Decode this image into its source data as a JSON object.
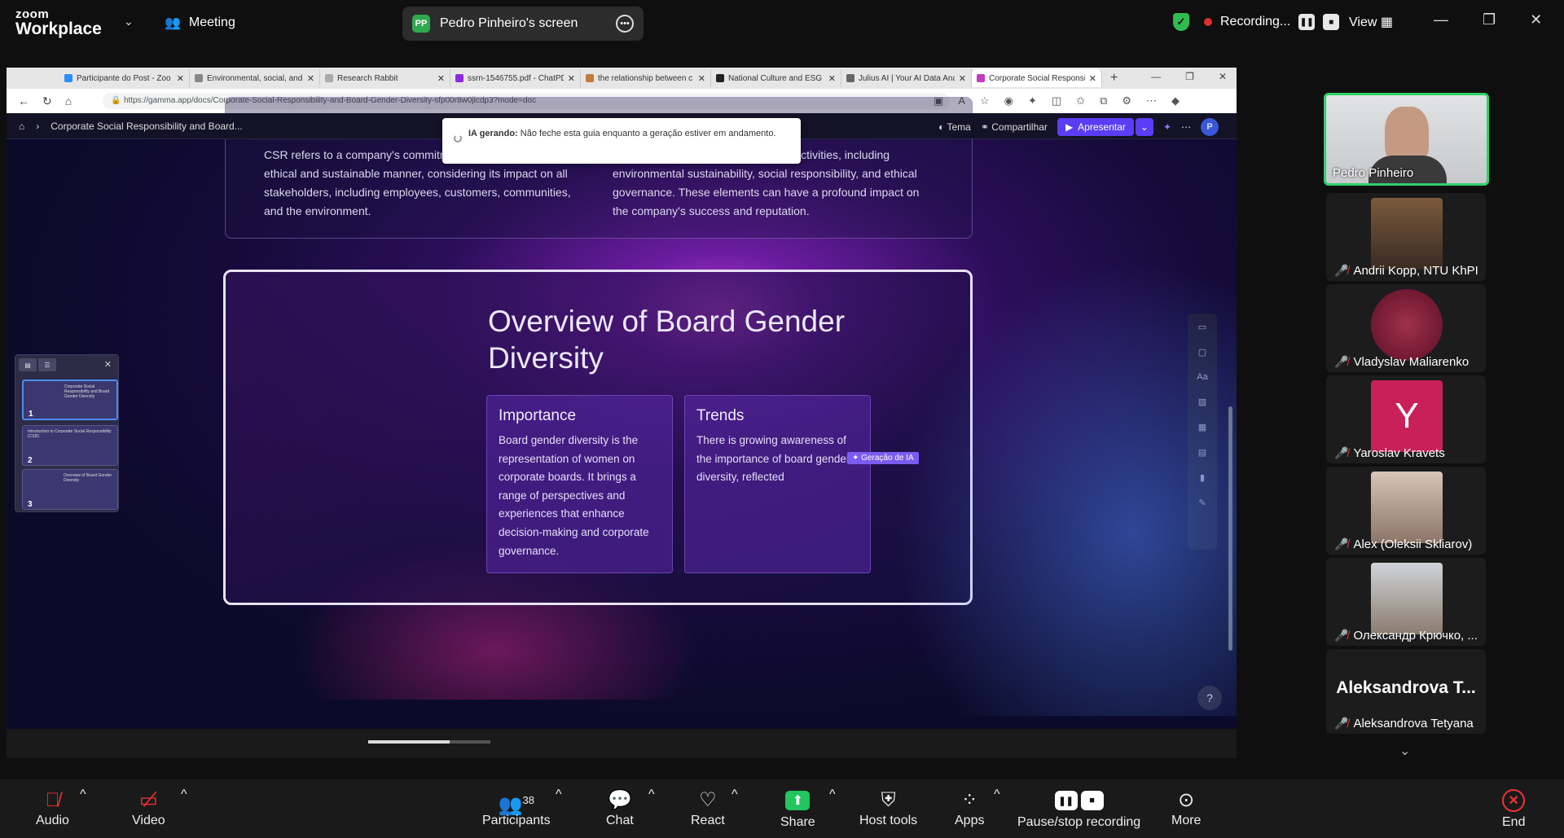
{
  "zoom": {
    "logo_line1": "zoom",
    "logo_line2": "Workplace",
    "meeting_label": "Meeting",
    "share_initials": "PP",
    "share_title": "Pedro Pinheiro's screen",
    "recording_label": "Recording...",
    "view_label": "View"
  },
  "browser": {
    "tabs": [
      {
        "title": "Participante do Post - Zoo"
      },
      {
        "title": "Environmental, social, and"
      },
      {
        "title": "Research Rabbit"
      },
      {
        "title": "ssrn-1546755.pdf - ChatPD"
      },
      {
        "title": "the relationship between c"
      },
      {
        "title": "National Culture and ESG I"
      },
      {
        "title": "Julius AI | Your AI Data Ana"
      },
      {
        "title": "Corporate Social Responsi"
      }
    ],
    "url": "https://gamma.app/docs/Corporate-Social-Responsibility-and-Board-Gender-Diversity-sfp00r8w0jlcdp3?mode=doc"
  },
  "gamma": {
    "breadcrumb": "Corporate Social Responsibility and Board...",
    "toast_bold": "IA gerando:",
    "toast_text": "Não feche esta guia enquanto a geração estiver em andamento.",
    "tema": "Tema",
    "compartilhar": "Compartilhar",
    "apresentar": "Apresentar",
    "avatar": "P",
    "csr_left": "CSR refers to a company's commitment to operate in an ethical and sustainable manner, considering its impact on all stakeholders, including employees, customers, communities, and the environment.",
    "csr_right": "CSR encompasses a wide range of activities, including environmental sustainability, social responsibility, and ethical governance. These elements can have a profound impact on the company's success and reputation.",
    "main_title": "Overview of Board Gender Diversity",
    "importance_title": "Importance",
    "importance_body": "Board gender diversity is the representation of women on corporate boards. It brings a range of perspectives and experiences that enhance decision-making and corporate governance.",
    "trends_title": "Trends",
    "trends_body": "There is growing awareness of the importance of board gender diversity, reflected",
    "ia_tag": "✦ Geração de IA",
    "thumbs": [
      {
        "num": "1",
        "title": "Corporate Social Responsibility and Board Gender Diversity"
      },
      {
        "num": "2",
        "title": "Introduction to Corporate Social Responsibility (CSR)"
      },
      {
        "num": "3",
        "title": "Overview of Board Gender Diversity"
      }
    ],
    "help": "?"
  },
  "gallery": [
    {
      "name": "Pedro Pinheiro"
    },
    {
      "name": "Andrii Kopp, NTU KhPI"
    },
    {
      "name": "Vladyslav Maliarenko"
    },
    {
      "name": "Yaroslav Kravets",
      "initial": "Y"
    },
    {
      "name": "Alex (Oleksii Skliarov)"
    },
    {
      "name": "Олександр Крючко, ..."
    },
    {
      "name": "Aleksandrova Tetyana",
      "big_name": "Aleksandrova T..."
    }
  ],
  "toolbar": {
    "audio": "Audio",
    "video": "Video",
    "participants": "Participants",
    "participants_count": "38",
    "chat": "Chat",
    "react": "React",
    "share": "Share",
    "host_tools": "Host tools",
    "apps": "Apps",
    "pause_stop": "Pause/stop recording",
    "more": "More",
    "end": "End"
  }
}
